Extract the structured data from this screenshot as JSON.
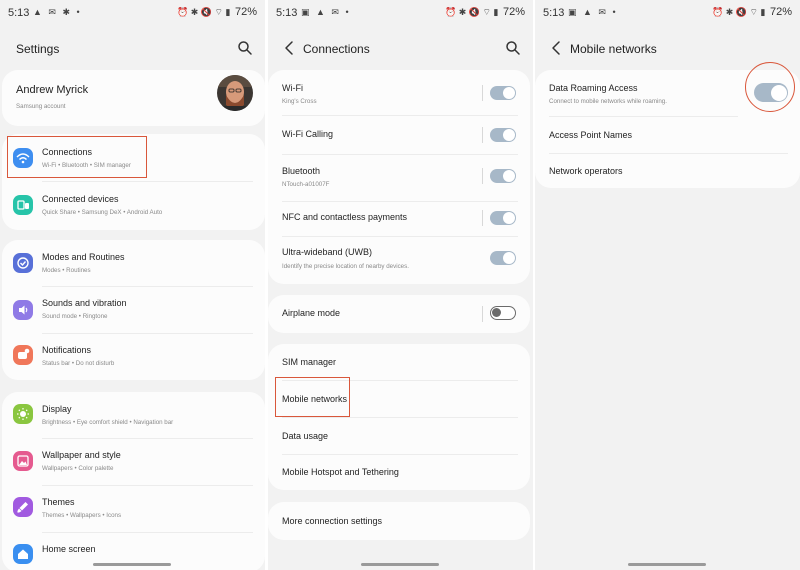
{
  "status_bar": {
    "time": "5:13",
    "battery": "72%"
  },
  "settings": {
    "title": "Settings",
    "profile": {
      "name": "Andrew Myrick",
      "sub": "Samsung account"
    },
    "items": [
      {
        "label": "Connections",
        "sub": "Wi-Fi  •  Bluetooth  •  SIM manager"
      },
      {
        "label": "Connected devices",
        "sub": "Quick Share  •  Samsung DeX  •  Android Auto"
      },
      {
        "label": "Modes and Routines",
        "sub": "Modes  •  Routines"
      },
      {
        "label": "Sounds and vibration",
        "sub": "Sound mode  •  Ringtone"
      },
      {
        "label": "Notifications",
        "sub": "Status bar  •  Do not disturb"
      },
      {
        "label": "Display",
        "sub": "Brightness  •  Eye comfort shield  •  Navigation bar"
      },
      {
        "label": "Wallpaper and style",
        "sub": "Wallpapers  •  Color palette"
      },
      {
        "label": "Themes",
        "sub": "Themes  •  Wallpapers  •  Icons"
      },
      {
        "label": "Home screen",
        "sub": ""
      }
    ]
  },
  "connections": {
    "title": "Connections",
    "items": [
      {
        "label": "Wi-Fi",
        "sub": "King's Cross",
        "toggle": "on"
      },
      {
        "label": "Wi-Fi Calling",
        "sub": "",
        "toggle": "on"
      },
      {
        "label": "Bluetooth",
        "sub": "NTouch-a01007F",
        "toggle": "on"
      },
      {
        "label": "NFC and contactless payments",
        "sub": "",
        "toggle": "on"
      },
      {
        "label": "Ultra-wideband (UWB)",
        "sub": "Identify the precise location of nearby devices.",
        "toggle": "on"
      },
      {
        "label": "Airplane mode",
        "sub": "",
        "toggle": "off"
      },
      {
        "label": "SIM manager"
      },
      {
        "label": "Mobile networks"
      },
      {
        "label": "Data usage"
      },
      {
        "label": "Mobile Hotspot and Tethering"
      },
      {
        "label": "More connection settings"
      }
    ]
  },
  "mobile_networks": {
    "title": "Mobile networks",
    "items": [
      {
        "label": "Data Roaming Access",
        "sub": "Connect to mobile networks while roaming.",
        "toggle": "on"
      },
      {
        "label": "Access Point Names"
      },
      {
        "label": "Network operators"
      }
    ]
  },
  "colors": {
    "highlight": "#d9573b",
    "toggle_on": "#a7b8c8",
    "connections_icon": "#3e8ef0",
    "connected_devices_icon": "#27c4a9",
    "modes_icon": "#5870d8",
    "sounds_icon": "#8f7ae6",
    "notifications_icon": "#f0775a",
    "display_icon": "#8ac640",
    "wallpaper_icon": "#e55a8f",
    "themes_icon": "#a15ae0",
    "home_icon": "#3a8ff0"
  }
}
